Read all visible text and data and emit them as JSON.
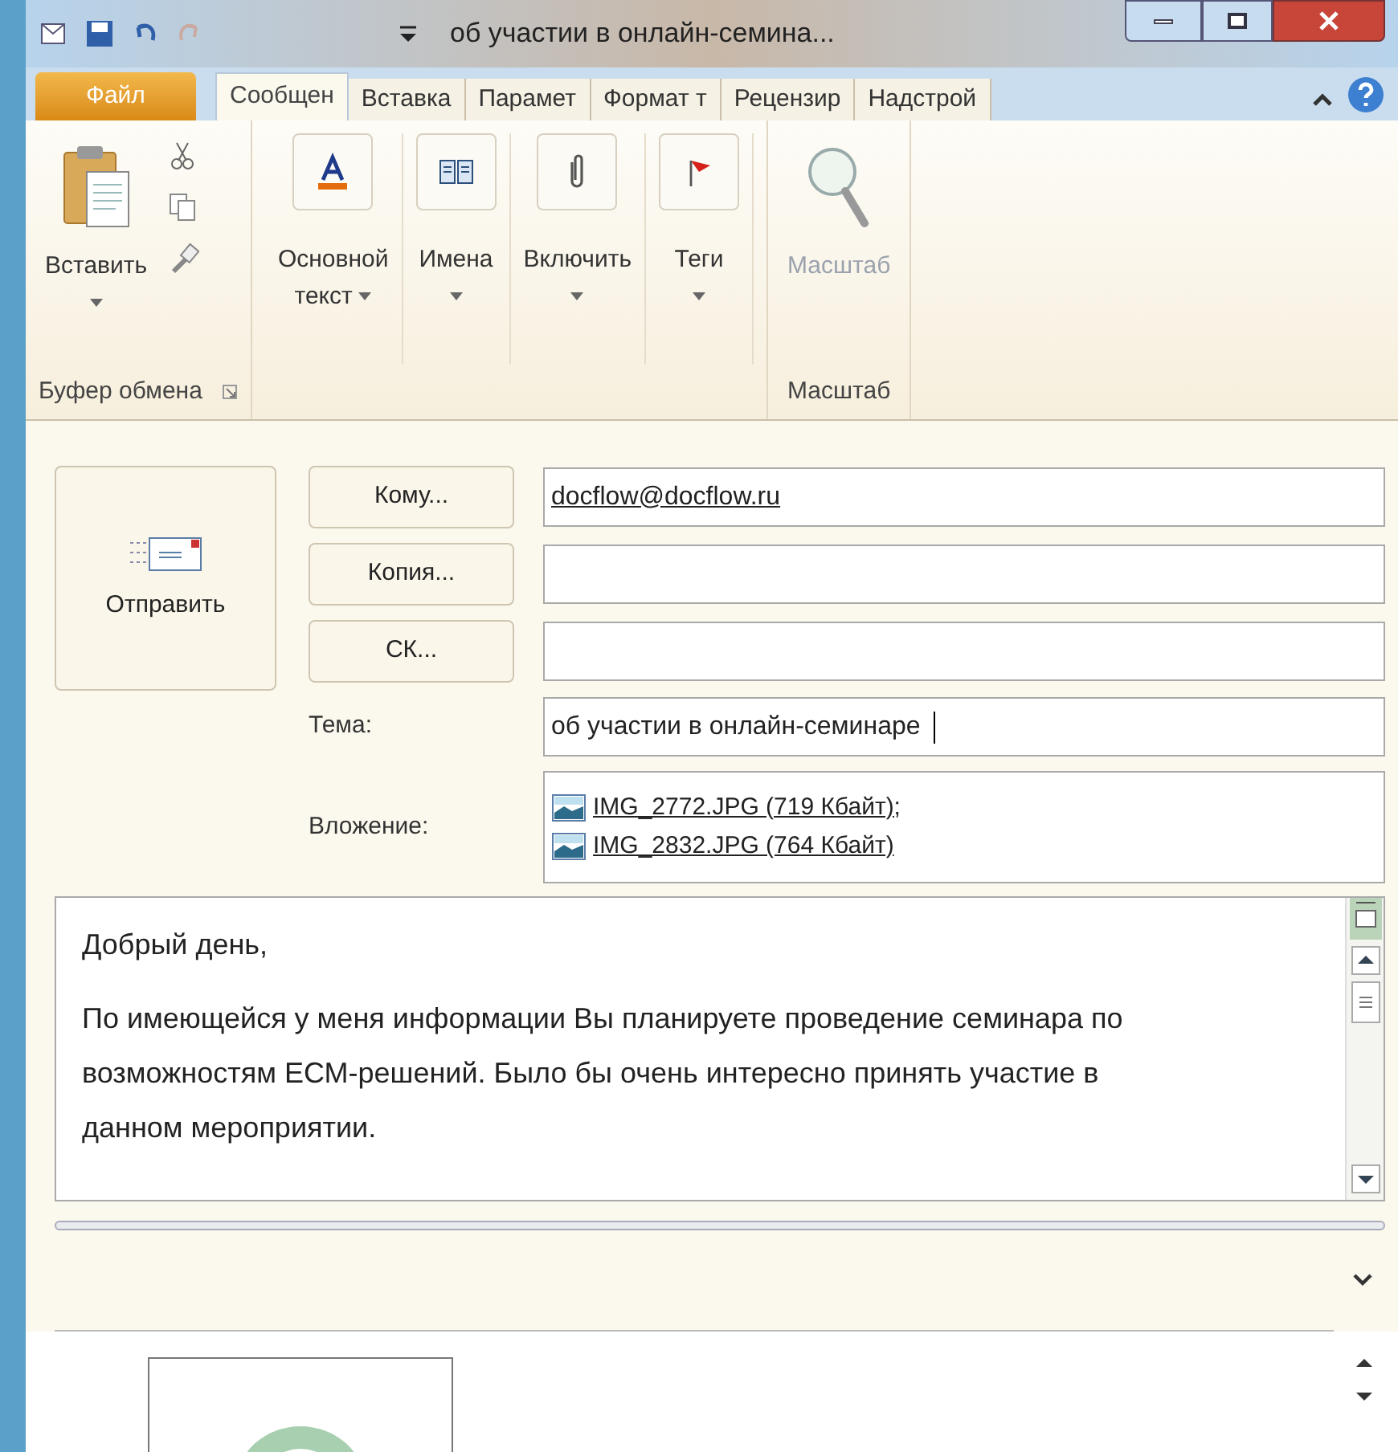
{
  "window": {
    "title": "об участии в онлайн-семина..."
  },
  "file_tab": {
    "label": "Файл"
  },
  "tabs": [
    {
      "label": "Сообщен",
      "selected": true
    },
    {
      "label": "Вставка",
      "selected": false
    },
    {
      "label": "Парамет",
      "selected": false
    },
    {
      "label": "Формат т",
      "selected": false
    },
    {
      "label": "Рецензир",
      "selected": false
    },
    {
      "label": "Надстрой",
      "selected": false
    }
  ],
  "ribbon": {
    "groups": [
      {
        "label": "Буфер обмена",
        "buttons": [
          {
            "kind": "paste",
            "label": "Вставить",
            "disabled": false
          }
        ]
      },
      {
        "buttons": [
          {
            "kind": "text",
            "label": "Основной",
            "label2": "текст",
            "disabled": false
          },
          {
            "kind": "names",
            "label": "Имена",
            "disabled": false
          },
          {
            "kind": "include",
            "label": "Включить",
            "disabled": false
          },
          {
            "kind": "tags",
            "label": "Теги",
            "disabled": false
          }
        ]
      },
      {
        "label": "Масштаб",
        "buttons": [
          {
            "kind": "zoom",
            "label": "Масштаб",
            "disabled": true
          }
        ]
      }
    ]
  },
  "send_button": {
    "label": "Отправить"
  },
  "address_rows": [
    {
      "button": "Кому...",
      "value": "docflow@docflow.ru"
    },
    {
      "button": "Копия..."
    },
    {
      "button": "СК..."
    }
  ],
  "subject": {
    "label": "Тема:",
    "value": "об участии в онлайн-семинаре"
  },
  "attachments": {
    "label": "Вложение:",
    "files": [
      "IMG_2772.JPG (719 Кбайт);",
      "IMG_2832.JPG (764 Кбайт)"
    ]
  },
  "body": {
    "greeting": "Добрый день,",
    "paragraph": "По имеющейся у меня информации Вы планируете проведение семинара по возможностям ЕСМ-решений. Было бы очень интересно принять участие в данном мероприятии."
  }
}
